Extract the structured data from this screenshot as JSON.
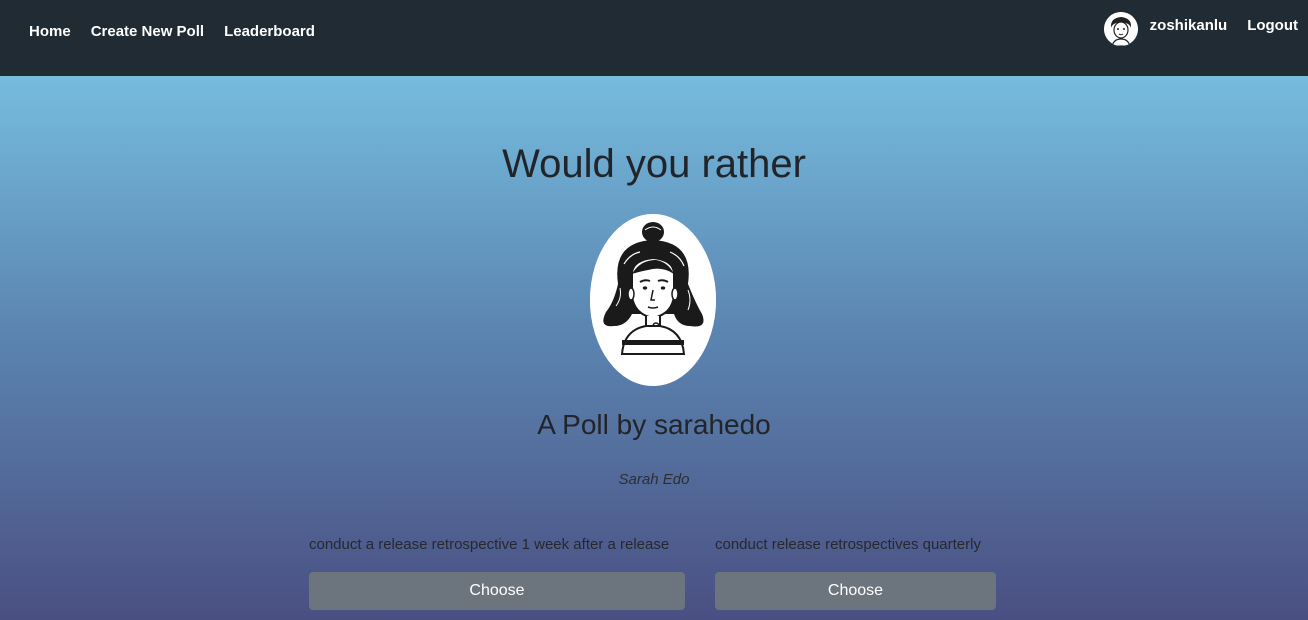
{
  "nav": {
    "home": "Home",
    "create": "Create New Poll",
    "leaderboard": "Leaderboard",
    "username": "zoshikanlu",
    "logout": "Logout"
  },
  "poll": {
    "title": "Would you rather",
    "poll_by": "A Poll by sarahedo",
    "author_name": "Sarah Edo",
    "option_one": "conduct a release retrospective 1 week after a release",
    "option_two": "conduct release retrospectives quarterly",
    "choose_one": "Choose",
    "choose_two": "Choose"
  },
  "icons": {
    "user_avatar": "user-avatar-icon",
    "author_avatar": "author-avatar-icon"
  }
}
